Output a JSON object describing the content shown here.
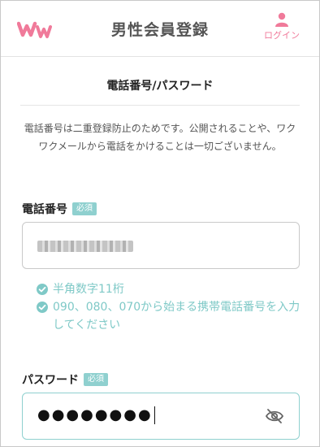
{
  "header": {
    "title": "男性会員登録",
    "login_label": "ログイン",
    "logo_icon": "ww-logo-icon",
    "login_icon": "user-icon"
  },
  "section": {
    "title": "電話番号/パスワード",
    "notice": "電話番号は二重登録防止のためです。公開されることや、ワクワクメールから電話をかけることは一切ございません。"
  },
  "phone": {
    "label": "電話番号",
    "badge": "必須",
    "value_obscured": true
  },
  "validation": {
    "items": [
      "半角数字11桁",
      "090、080、070から始まる携帯電話番号を入力してください"
    ],
    "icon": "check-circle-icon",
    "color": "#7fc9c7"
  },
  "password": {
    "label": "パスワード",
    "badge": "必須",
    "value": "●●●●●●●●",
    "toggle_icon": "eye-slash-icon"
  },
  "colors": {
    "brand_pink": "#f07a9a",
    "accent_teal": "#8fd0cf"
  }
}
